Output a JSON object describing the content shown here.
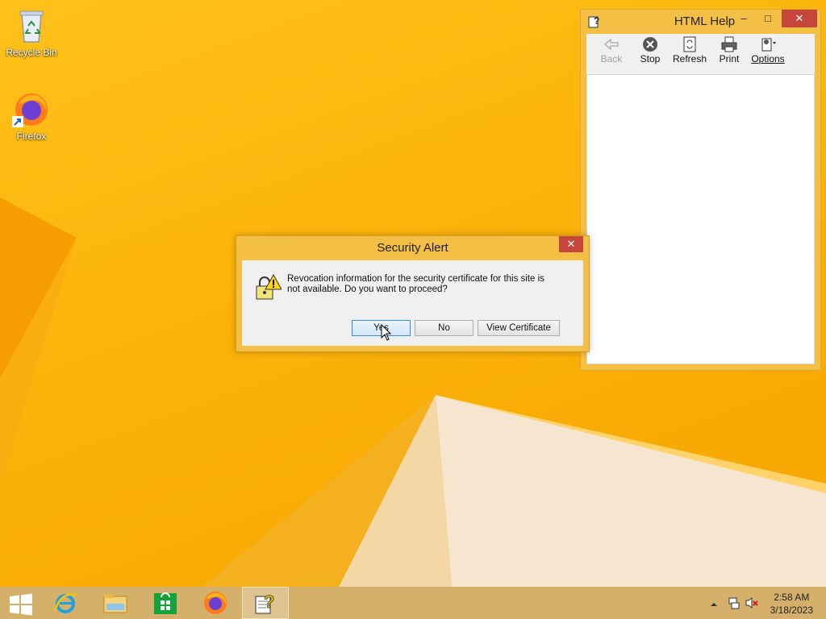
{
  "desktop": {
    "icons": [
      {
        "label": "Recycle Bin",
        "icon": "recycle-bin-icon"
      },
      {
        "label": "Firefox",
        "icon": "firefox-icon"
      }
    ]
  },
  "help_window": {
    "title": "HTML Help",
    "controls": {
      "minimize": "–",
      "maximize": "□",
      "close": "✕"
    },
    "toolbar": {
      "back": "Back",
      "stop": "Stop",
      "refresh": "Refresh",
      "print": "Print",
      "options": "Options"
    }
  },
  "security_alert": {
    "title": "Security Alert",
    "close": "✕",
    "message": "Revocation information for the security certificate for this site is not available. Do you want to proceed?",
    "buttons": {
      "yes": "Yes",
      "no": "No",
      "view_certificate": "View Certificate"
    }
  },
  "taskbar": {
    "items": [
      "start-icon",
      "internet-explorer-icon",
      "file-explorer-icon",
      "store-icon",
      "firefox-icon",
      "html-help-icon"
    ],
    "clock": {
      "time": "2:58 AM",
      "date": "3/18/2023"
    }
  },
  "colors": {
    "desktop": "#f7b500",
    "window_frame": "#f4bf45",
    "close_button": "#c7463b",
    "taskbar": "#d5b06a"
  }
}
